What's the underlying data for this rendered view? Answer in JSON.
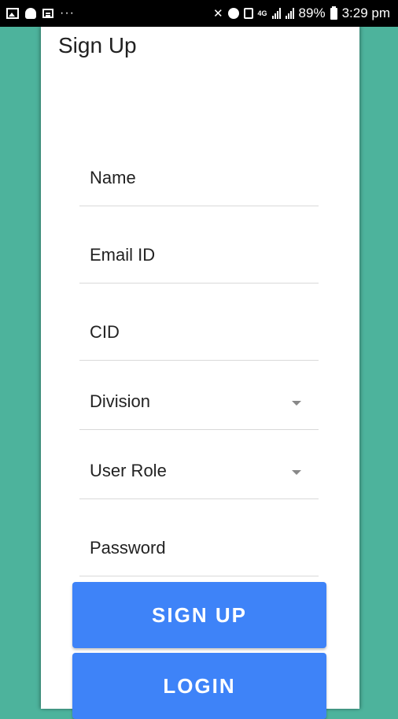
{
  "statusbar": {
    "left_icons": [
      "gallery-icon",
      "snapchat-icon",
      "news-icon",
      "more-dots-icon"
    ],
    "dots": "···",
    "right_icons": [
      "mute-icon",
      "alarm-icon",
      "nfc-icon",
      "lte-icon",
      "signal-icon",
      "signal-icon",
      "battery-icon"
    ],
    "network": "4G",
    "battery_percent": "89%",
    "time": "3:29 pm"
  },
  "page": {
    "title": "Sign Up"
  },
  "form": {
    "name_placeholder": "Name",
    "email_placeholder": "Email ID",
    "cid_placeholder": "CID",
    "division_placeholder": "Division",
    "role_placeholder": "User Role",
    "password_placeholder": "Password"
  },
  "actions": {
    "signup_label": "SIGN UP",
    "login_label": "LOGIN"
  },
  "colors": {
    "background": "#4db39c",
    "button": "#3e83f8",
    "statusbar": "#000000"
  }
}
